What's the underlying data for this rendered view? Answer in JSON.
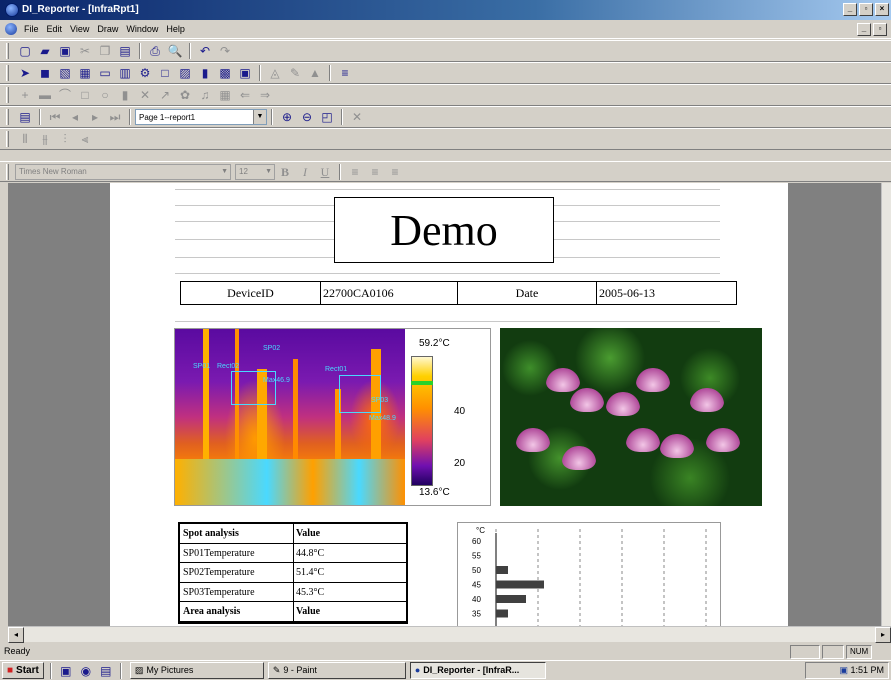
{
  "window": {
    "title": "DI_Reporter - [InfraRpt1]"
  },
  "menu": [
    "File",
    "Edit",
    "View",
    "Draw",
    "Window",
    "Help"
  ],
  "toolbar_nav": {
    "page_select": "Page 1--report1"
  },
  "toolbar_font": {
    "font": "Times New Roman",
    "size": "12",
    "bold": "B",
    "italic": "I",
    "underline": "U"
  },
  "report": {
    "title": "Demo",
    "device_label": "DeviceID",
    "device_id": "22700CA0106",
    "date_label": "Date",
    "date": "2005-06-13",
    "thermal": {
      "max_label": "59.2°C",
      "min_label": "13.6°C",
      "tick_40": "40",
      "tick_20": "20",
      "spots": [
        "SP02",
        "SP01",
        "SP03",
        "Rect02",
        "Rect01",
        "Max46.9",
        "Max48.9"
      ]
    },
    "spot_table": {
      "header": [
        "Spot analysis",
        "Value"
      ],
      "rows": [
        [
          "SP01Temperature",
          "44.8°C"
        ],
        [
          "SP02Temperature",
          "51.4°C"
        ],
        [
          "SP03Temperature",
          "45.3°C"
        ]
      ],
      "area_header": [
        "Area analysis",
        "Value"
      ]
    },
    "histogram": {
      "unit": "°C",
      "ticks": [
        "60",
        "55",
        "50",
        "45",
        "40",
        "35"
      ],
      "values": [
        0,
        0,
        2,
        8,
        5,
        2
      ]
    }
  },
  "statusbar": {
    "text": "Ready",
    "num": "NUM"
  },
  "taskbar": {
    "start": "Start",
    "items": [
      "My Pictures",
      "9 - Paint",
      "DI_Reporter - [InfraR..."
    ],
    "clock": "1:51 PM"
  }
}
